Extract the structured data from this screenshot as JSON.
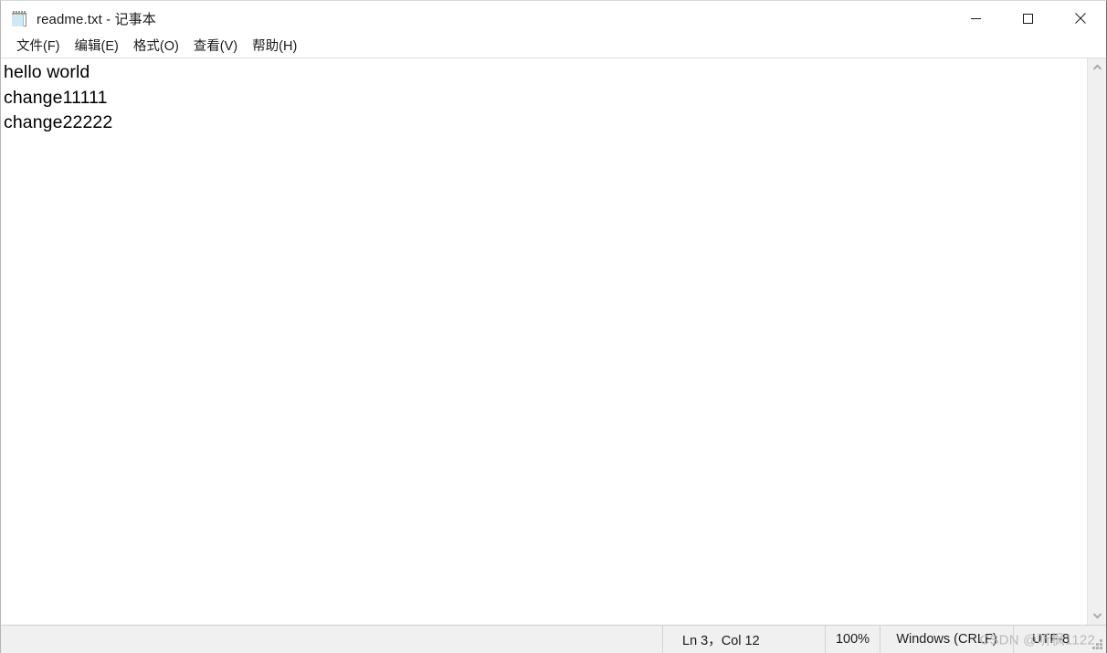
{
  "window": {
    "title": "readme.txt - 记事本",
    "icon": "notepad-icon",
    "controls": {
      "minimize_label": "最小化",
      "maximize_label": "最大化",
      "close_label": "关闭"
    }
  },
  "menu": {
    "items": [
      {
        "label": "文件(F)"
      },
      {
        "label": "编辑(E)"
      },
      {
        "label": "格式(O)"
      },
      {
        "label": "查看(V)"
      },
      {
        "label": "帮助(H)"
      }
    ]
  },
  "editor": {
    "lines": [
      "hello world",
      "change11111",
      "change22222"
    ]
  },
  "scrollbar": {
    "up_arrow": "chevron-up-icon",
    "down_arrow": "chevron-down-icon"
  },
  "status_bar": {
    "position": "Ln 3，Col 12",
    "zoom": "100%",
    "line_ending": "Windows (CRLF)",
    "encoding": "UTF-8"
  },
  "watermark": {
    "text": "CSDN @听枫1122"
  },
  "colors": {
    "window_bg": "#ffffff",
    "status_bg": "#f0f0f0",
    "border": "#6e6e6e",
    "text": "#000000",
    "watermark": "#b9b9b9"
  }
}
